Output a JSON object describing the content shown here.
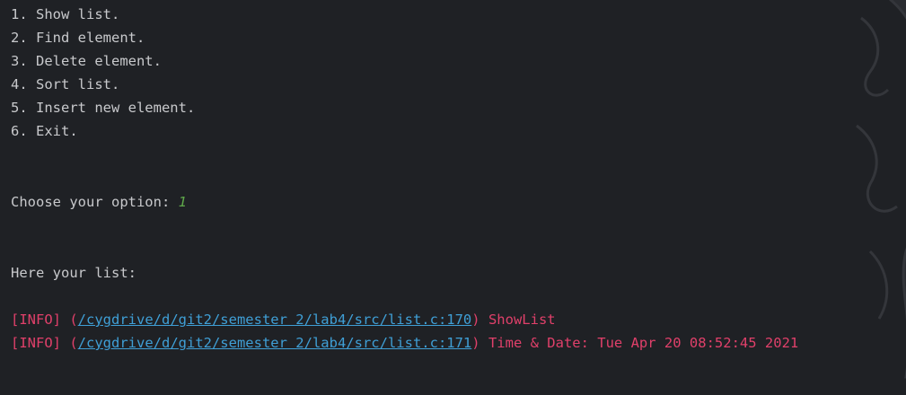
{
  "menu": {
    "items": [
      "1. Show list.",
      "2. Find element.",
      "3. Delete element.",
      "4. Sort list.",
      "5. Insert new element.",
      "6. Exit."
    ]
  },
  "prompt": {
    "label": "Choose your option: ",
    "value": "1"
  },
  "output": {
    "list_header": "Here your list:"
  },
  "logs": [
    {
      "level": "[INFO]",
      "open_paren": " (",
      "path": "/cygdrive/d/git2/semester 2/lab4/src/list.c:170",
      "close_paren": ")",
      "message": " ShowList"
    },
    {
      "level": "[INFO]",
      "open_paren": " (",
      "path": "/cygdrive/d/git2/semester 2/lab4/src/list.c:171",
      "close_paren": ")",
      "message": " Time & Date: Tue Apr 20 08:52:45 2021"
    }
  ],
  "colors": {
    "background": "#1f2125",
    "text": "#c8c9cc",
    "input": "#5fa84a",
    "log": "#e0406a",
    "link": "#3f9fd6"
  }
}
